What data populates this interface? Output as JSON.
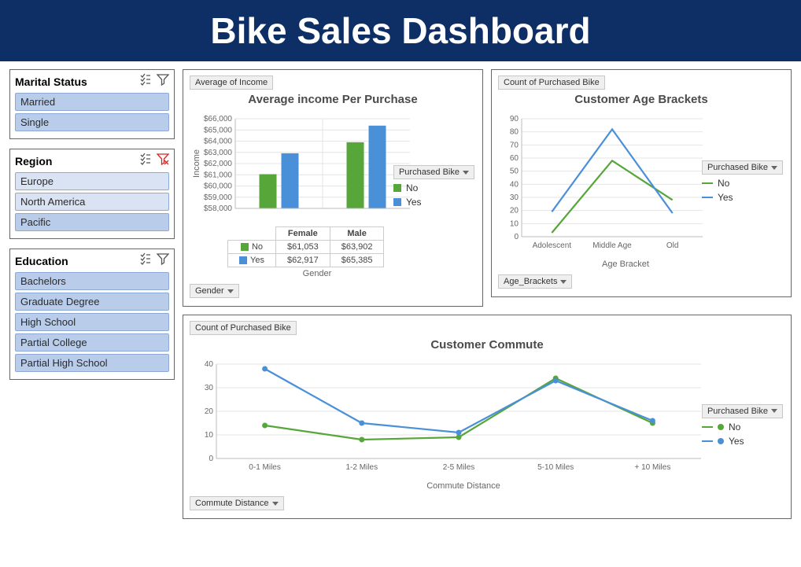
{
  "banner": {
    "title": "Bike Sales Dashboard"
  },
  "colors": {
    "no": "#57a639",
    "yes": "#4a90d9"
  },
  "slicers": {
    "marital": {
      "title": "Marital Status",
      "filter_active": false,
      "items": [
        {
          "label": "Married",
          "selected": true
        },
        {
          "label": "Single",
          "selected": true
        }
      ]
    },
    "region": {
      "title": "Region",
      "filter_active": true,
      "items": [
        {
          "label": "Europe",
          "selected": false
        },
        {
          "label": "North America",
          "selected": false
        },
        {
          "label": "Pacific",
          "selected": true
        }
      ]
    },
    "education": {
      "title": "Education",
      "filter_active": false,
      "items": [
        {
          "label": "Bachelors",
          "selected": true
        },
        {
          "label": "Graduate Degree",
          "selected": true
        },
        {
          "label": "High School",
          "selected": true
        },
        {
          "label": "Partial College",
          "selected": true
        },
        {
          "label": "Partial High School",
          "selected": true
        }
      ]
    }
  },
  "chart_data": [
    {
      "id": "income",
      "type": "bar",
      "title": "Average income Per Purchase",
      "value_field": "Average of Income",
      "row_field": "Gender",
      "legend_title": "Purchased Bike",
      "xlabel": "Gender",
      "ylabel": "Income",
      "categories": [
        "Female",
        "Male"
      ],
      "series": [
        {
          "name": "No",
          "values": [
            61053,
            63902
          ],
          "display": [
            "$61,053",
            "$63,902"
          ]
        },
        {
          "name": "Yes",
          "values": [
            62917,
            65385
          ],
          "display": [
            "$62,917",
            "$65,385"
          ]
        }
      ],
      "ylim": [
        58000,
        66000
      ],
      "yticks": [
        "$58,000",
        "$59,000",
        "$60,000",
        "$61,000",
        "$62,000",
        "$63,000",
        "$64,000",
        "$65,000",
        "$66,000"
      ]
    },
    {
      "id": "age",
      "type": "line",
      "title": "Customer Age Brackets",
      "value_field": "Count of Purchased Bike",
      "row_field": "Age_Brackets",
      "legend_title": "Purchased Bike",
      "xlabel": "Age Bracket",
      "ylabel": "",
      "categories": [
        "Adolescent",
        "Middle Age",
        "Old"
      ],
      "series": [
        {
          "name": "No",
          "values": [
            3,
            58,
            28
          ]
        },
        {
          "name": "Yes",
          "values": [
            19,
            82,
            18
          ]
        }
      ],
      "ylim": [
        0,
        90
      ],
      "yticks": [
        "0",
        "10",
        "20",
        "30",
        "40",
        "50",
        "60",
        "70",
        "80",
        "90"
      ]
    },
    {
      "id": "commute",
      "type": "line",
      "title": "Customer Commute",
      "value_field": "Count of Purchased Bike",
      "row_field": "Commute Distance",
      "legend_title": "Purchased Bike",
      "xlabel": "Commute Distance",
      "ylabel": "",
      "categories": [
        "0-1 Miles",
        "1-2 Miles",
        "2-5 Miles",
        "5-10 Miles",
        "+ 10 Miles"
      ],
      "series": [
        {
          "name": "No",
          "values": [
            14,
            8,
            9,
            34,
            15
          ]
        },
        {
          "name": "Yes",
          "values": [
            38,
            15,
            11,
            33,
            16
          ]
        }
      ],
      "ylim": [
        0,
        40
      ],
      "yticks": [
        "0",
        "10",
        "20",
        "30",
        "40"
      ]
    }
  ],
  "legend_labels": {
    "no": "No",
    "yes": "Yes"
  }
}
